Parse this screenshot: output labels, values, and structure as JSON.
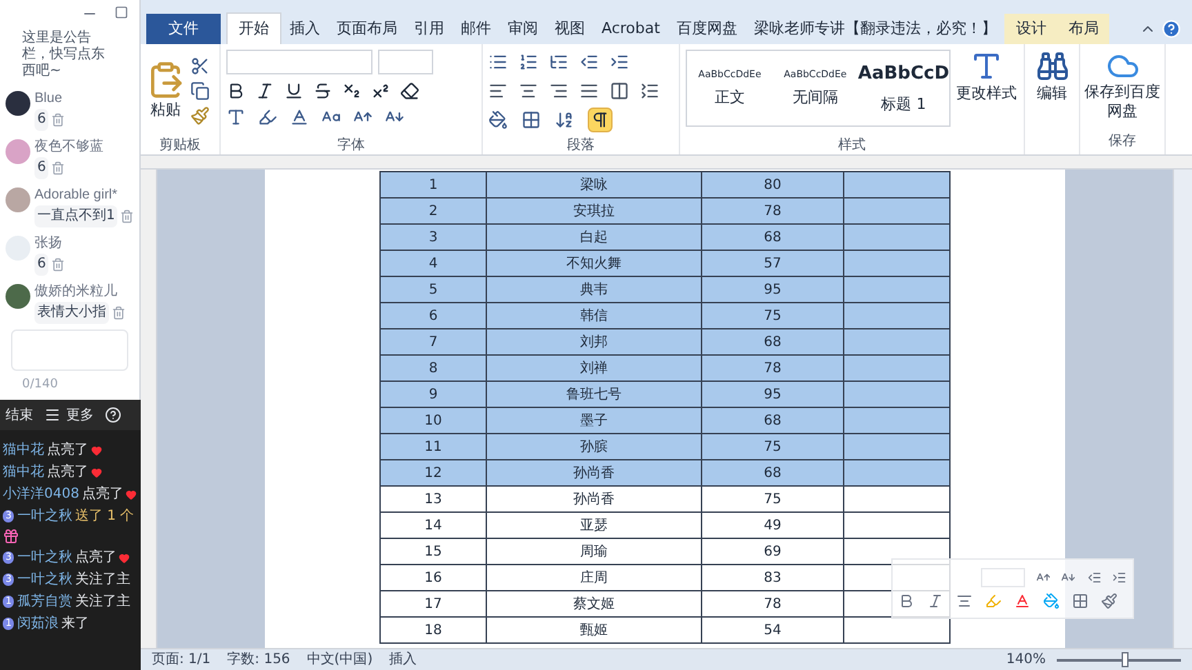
{
  "chat_panel": {
    "announcement": "这里是公告栏，快写点东西吧~",
    "messages": [
      {
        "user": "Blue",
        "text": "6",
        "color": "#2a2f3f"
      },
      {
        "user": "夜色不够蓝",
        "text": "6",
        "color": "#d9a3c6"
      },
      {
        "user": "Adorable girl*",
        "text": "一直点不到1",
        "color": "#b9a7a3"
      },
      {
        "user": "张扬",
        "text": "6",
        "color": "#e9eef3"
      },
      {
        "user": "傲娇的米粒儿",
        "text": "表情大小指",
        "color": "#4d6a4a"
      }
    ],
    "counter": "0/140"
  },
  "live_bar": {
    "buttons": [
      {
        "kind": "end",
        "label": "结束"
      },
      {
        "kind": "more",
        "label": "更多"
      },
      {
        "kind": "help"
      }
    ]
  },
  "live_feed": [
    {
      "kind": "light",
      "user": "猫中花",
      "action": "点亮了"
    },
    {
      "kind": "light",
      "user": "猫中花",
      "action": "点亮了"
    },
    {
      "kind": "light",
      "user": "小洋洋0408",
      "action": "点亮了"
    },
    {
      "kind": "gift",
      "badge": "3",
      "user": "一叶之秋",
      "action": "送了 1 个"
    },
    {
      "kind": "light",
      "badge": "3",
      "user": "一叶之秋",
      "action": "点亮了"
    },
    {
      "kind": "follow",
      "badge": "3",
      "user": "一叶之秋",
      "action": "关注了主"
    },
    {
      "kind": "follow",
      "badge": "1",
      "user": "孤芳自赏",
      "action": "关注了主"
    },
    {
      "kind": "enter",
      "badge": "1",
      "user": "闵茹浪",
      "action": "来了"
    }
  ],
  "tabs": [
    {
      "label": "文件",
      "kind": "file",
      "selected": false
    },
    {
      "label": "开始",
      "kind": "tab",
      "selected": true
    },
    {
      "label": "插入",
      "kind": "tab",
      "selected": false
    },
    {
      "label": "页面布局",
      "kind": "tab",
      "selected": false
    },
    {
      "label": "引用",
      "kind": "tab",
      "selected": false
    },
    {
      "label": "邮件",
      "kind": "tab",
      "selected": false
    },
    {
      "label": "审阅",
      "kind": "tab",
      "selected": false
    },
    {
      "label": "视图",
      "kind": "tab",
      "selected": false
    },
    {
      "label": "Acrobat",
      "kind": "tab",
      "selected": false
    },
    {
      "label": "百度网盘",
      "kind": "tab",
      "selected": false
    },
    {
      "label": "梁咏老师专讲【翻录违法，必究！】",
      "kind": "tab",
      "selected": false
    },
    {
      "label": "设计",
      "kind": "context",
      "selected": false
    },
    {
      "label": "布局",
      "kind": "context",
      "selected": false
    }
  ],
  "ribbon": {
    "clipboard": {
      "label": "剪贴板",
      "paste": "粘贴"
    },
    "font": {
      "label": "字体"
    },
    "paragraph": {
      "label": "段落",
      "show_marks": {
        "on": true
      }
    },
    "styles": {
      "label": "样式",
      "items": [
        {
          "sample": "AaBbCcDdEe",
          "name": "正文",
          "kind": "small"
        },
        {
          "sample": "AaBbCcDdEe",
          "name": "无间隔",
          "kind": "small"
        },
        {
          "sample": "AaBbCcD",
          "name": "标题 1",
          "kind": "heading"
        }
      ],
      "change": "更改样式"
    },
    "editing": {
      "button": "编辑"
    },
    "save": {
      "label": "保存",
      "button": "保存到百度网盘"
    }
  },
  "table": {
    "rows": [
      {
        "cells": [
          "1",
          "梁咏",
          "80"
        ],
        "selected": true
      },
      {
        "cells": [
          "2",
          "安琪拉",
          "78"
        ],
        "selected": true
      },
      {
        "cells": [
          "3",
          "白起",
          "68"
        ],
        "selected": true
      },
      {
        "cells": [
          "4",
          "不知火舞",
          "57"
        ],
        "selected": true
      },
      {
        "cells": [
          "5",
          "典韦",
          "95"
        ],
        "selected": true
      },
      {
        "cells": [
          "6",
          "韩信",
          "75"
        ],
        "selected": true
      },
      {
        "cells": [
          "7",
          "刘邦",
          "68"
        ],
        "selected": true
      },
      {
        "cells": [
          "8",
          "刘禅",
          "78"
        ],
        "selected": true
      },
      {
        "cells": [
          "9",
          "鲁班七号",
          "95"
        ],
        "selected": true
      },
      {
        "cells": [
          "10",
          "墨子",
          "68"
        ],
        "selected": true
      },
      {
        "cells": [
          "11",
          "孙膑",
          "75"
        ],
        "selected": true
      },
      {
        "cells": [
          "12",
          "孙尚香",
          "68"
        ],
        "selected": true
      },
      {
        "cells": [
          "13",
          "孙尚香",
          "75"
        ],
        "selected": false
      },
      {
        "cells": [
          "14",
          "亚瑟",
          "49"
        ],
        "selected": false
      },
      {
        "cells": [
          "15",
          "周瑜",
          "69"
        ],
        "selected": false
      },
      {
        "cells": [
          "16",
          "庄周",
          "83"
        ],
        "selected": false
      },
      {
        "cells": [
          "17",
          "蔡文姬",
          "78"
        ],
        "selected": false
      },
      {
        "cells": [
          "18",
          "甄姬",
          "54"
        ],
        "selected": false
      }
    ]
  },
  "status_bar": {
    "items": [
      "页面: 1/1",
      "字数: 156",
      "中文(中国)",
      "插入"
    ],
    "zoom": {
      "reading": "140%",
      "level": 0.55
    }
  }
}
